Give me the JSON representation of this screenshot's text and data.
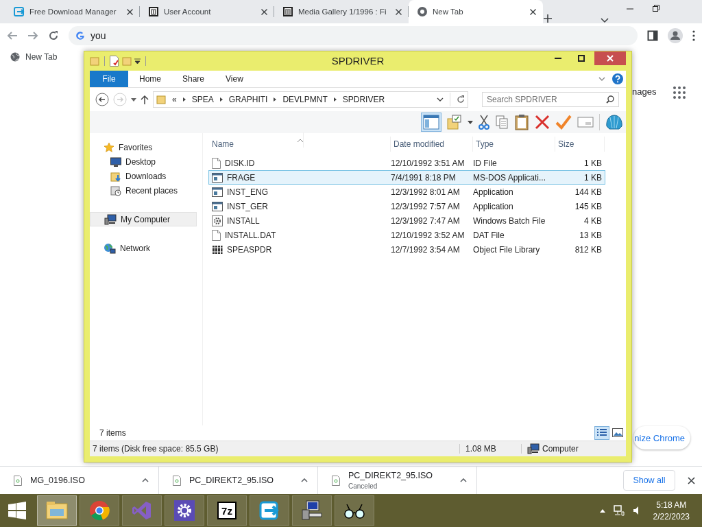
{
  "browser": {
    "tabs": [
      {
        "title": "Free Download Manager",
        "kind": "fdm",
        "selected": false
      },
      {
        "title": "User Account",
        "kind": "museum",
        "selected": false
      },
      {
        "title": "Media Gallery 1/1996 : Fi",
        "kind": "museum",
        "selected": false
      },
      {
        "title": "New Tab",
        "kind": "chrome",
        "selected": true
      }
    ],
    "omnibox": {
      "value": "you"
    },
    "bookmarks": [
      {
        "label": "New Tab"
      }
    ],
    "page": {
      "images_link": "nages",
      "customize_button": "nize Chrome"
    }
  },
  "explorer": {
    "title": "SPDRIVER",
    "file_button": "File",
    "ribbon_tabs": [
      "Home",
      "Share",
      "View"
    ],
    "overflow": "«",
    "path": [
      "SPEA",
      "GRAPHITI",
      "DEVLPMNT",
      "SPDRIVER"
    ],
    "search": {
      "placeholder": "Search SPDRIVER"
    },
    "nav": [
      {
        "label": "Favorites",
        "kind": "star",
        "selected": false,
        "children": [
          {
            "label": "Desktop",
            "kind": "desktop",
            "selected": false
          },
          {
            "label": "Downloads",
            "kind": "downloads",
            "selected": false
          },
          {
            "label": "Recent places",
            "kind": "recent",
            "selected": false
          }
        ]
      },
      {
        "label": "My Computer",
        "kind": "computer",
        "selected": true
      },
      {
        "label": "Network",
        "kind": "network",
        "selected": false
      }
    ],
    "columns": [
      "Name",
      "Date modified",
      "Type",
      "Size"
    ],
    "files": [
      {
        "name": "DISK.ID",
        "date": "12/10/1992 3:51 AM",
        "type": "ID File",
        "size": "1 KB",
        "kind": "blank",
        "selected": false
      },
      {
        "name": "FRAGE",
        "date": "7/4/1991 8:18 PM",
        "type": "MS-DOS Applicati...",
        "size": "1 KB",
        "kind": "app",
        "selected": true
      },
      {
        "name": "INST_ENG",
        "date": "12/3/1992 8:01 AM",
        "type": "Application",
        "size": "144 KB",
        "kind": "app",
        "selected": false
      },
      {
        "name": "INST_GER",
        "date": "12/3/1992 7:57 AM",
        "type": "Application",
        "size": "145 KB",
        "kind": "app",
        "selected": false
      },
      {
        "name": "INSTALL",
        "date": "12/3/1992 7:47 AM",
        "type": "Windows Batch File",
        "size": "4 KB",
        "kind": "batch",
        "selected": false
      },
      {
        "name": "INSTALL.DAT",
        "date": "12/10/1992 3:52 AM",
        "type": "DAT File",
        "size": "13 KB",
        "kind": "blank",
        "selected": false
      },
      {
        "name": "SPEASPDR",
        "date": "12/7/1992 3:54 AM",
        "type": "Object File Library",
        "size": "812 KB",
        "kind": "library",
        "selected": false
      }
    ],
    "item_count": "7 items",
    "status": {
      "summary": "7 items (Disk free space: 85.5 GB)",
      "size": "1.08 MB",
      "location": "Computer"
    }
  },
  "downloads": [
    {
      "name": "MG_0196.ISO"
    },
    {
      "name": "PC_DIREKT2_95.ISO"
    },
    {
      "name": "PC_DIREKT2_95.ISO",
      "status": "Canceled"
    }
  ],
  "show_all": "Show all",
  "taskbar": {
    "apps": [
      {
        "kind": "explorer",
        "selected": true
      },
      {
        "kind": "chrome",
        "selected": false
      },
      {
        "kind": "vs",
        "selected": false
      },
      {
        "kind": "settings",
        "selected": false
      },
      {
        "kind": "sevenzip",
        "label": "7z",
        "selected": false
      },
      {
        "kind": "fdm",
        "selected": false
      },
      {
        "kind": "pc",
        "selected": false
      },
      {
        "kind": "glasses",
        "selected": false
      }
    ],
    "time": "5:18 AM",
    "date": "2/22/2023"
  }
}
